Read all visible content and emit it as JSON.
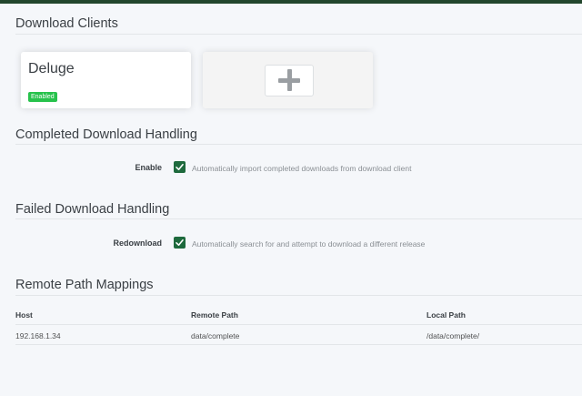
{
  "download_clients": {
    "title": "Download Clients",
    "clients": [
      {
        "name": "Deluge",
        "status": "Enabled"
      }
    ],
    "colors": {
      "enabled_badge": "#27c24c"
    }
  },
  "completed": {
    "title": "Completed Download Handling",
    "field_label": "Enable",
    "checked": true,
    "help": "Automatically import completed downloads from download client"
  },
  "failed": {
    "title": "Failed Download Handling",
    "field_label": "Redownload",
    "checked": true,
    "help": "Automatically search for and attempt to download a different release"
  },
  "remote_paths": {
    "title": "Remote Path Mappings",
    "columns": [
      "Host",
      "Remote Path",
      "Local Path"
    ],
    "rows": [
      {
        "host": "192.168.1.34",
        "remote": "data/complete",
        "local": "/data/complete/"
      }
    ]
  },
  "icons": {
    "add": "plus-icon",
    "check": "check-icon"
  },
  "colors": {
    "checkbox": "#1e6a3d",
    "topbar": "#22462d"
  }
}
